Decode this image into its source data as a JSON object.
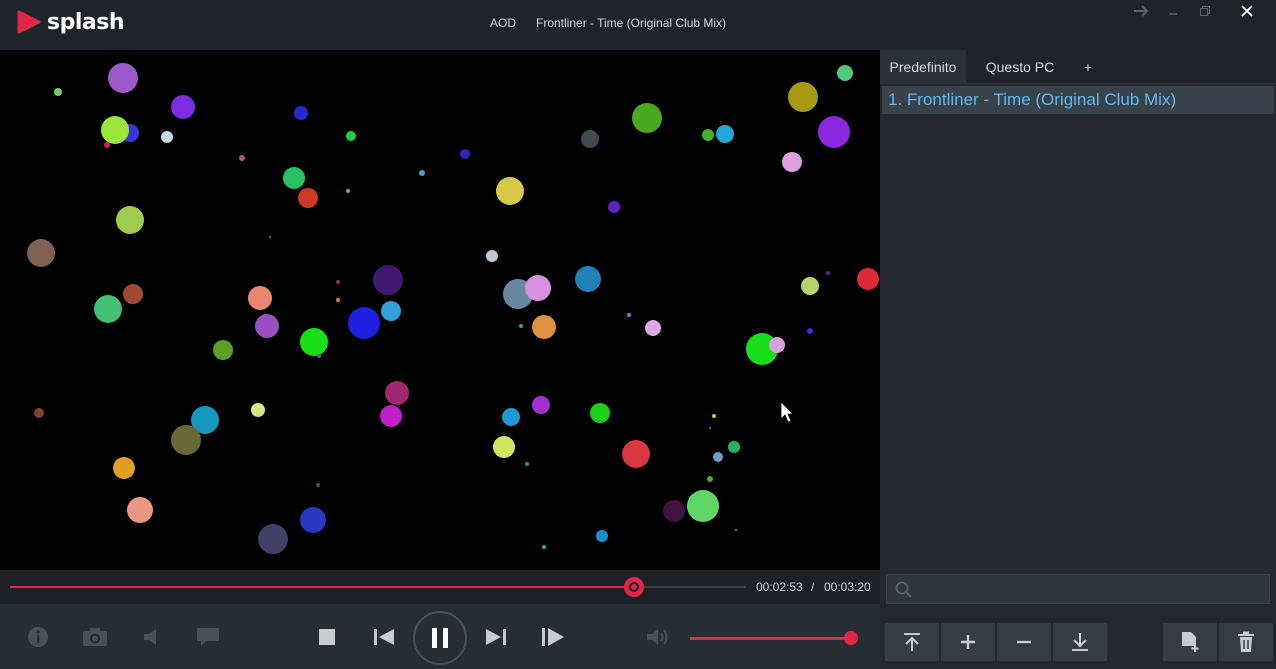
{
  "app": {
    "name": "splash",
    "brand_color": "#e0274a"
  },
  "titlebar": {
    "mode_label": "AOD",
    "now_playing": "Frontliner - Time (Original Club Mix)",
    "controls": [
      "arrow-right-icon",
      "minimize-icon",
      "restore-icon",
      "close-icon"
    ]
  },
  "playback": {
    "elapsed": "00:02:53",
    "separator": "/",
    "duration": "00:03:20",
    "progress_fraction": 0.865,
    "volume_fraction": 1.0
  },
  "controls": {
    "left_icons": [
      "info-icon",
      "snapshot-icon",
      "audio-track-icon",
      "subtitle-icon"
    ],
    "transport_icons": [
      "stop-icon",
      "previous-icon",
      "pause-icon",
      "next-icon",
      "frame-step-icon"
    ],
    "volume_icon": "volume-icon"
  },
  "playlist": {
    "tabs": [
      {
        "label": "Predefinito",
        "active": true
      },
      {
        "label": "Questo PC",
        "active": false
      },
      {
        "label": "+",
        "active": false
      }
    ],
    "items": [
      {
        "label": "1. Frontliner - Time (Original Club Mix)",
        "selected": true
      }
    ],
    "search_placeholder": "",
    "buttons": [
      "move-top-icon",
      "add-icon",
      "remove-icon",
      "move-bottom-icon",
      "new-playlist-icon",
      "delete-icon"
    ]
  },
  "colors": {
    "accent": "#e0274a",
    "selected_text": "#5cb8f0",
    "background": "#1f242b"
  }
}
